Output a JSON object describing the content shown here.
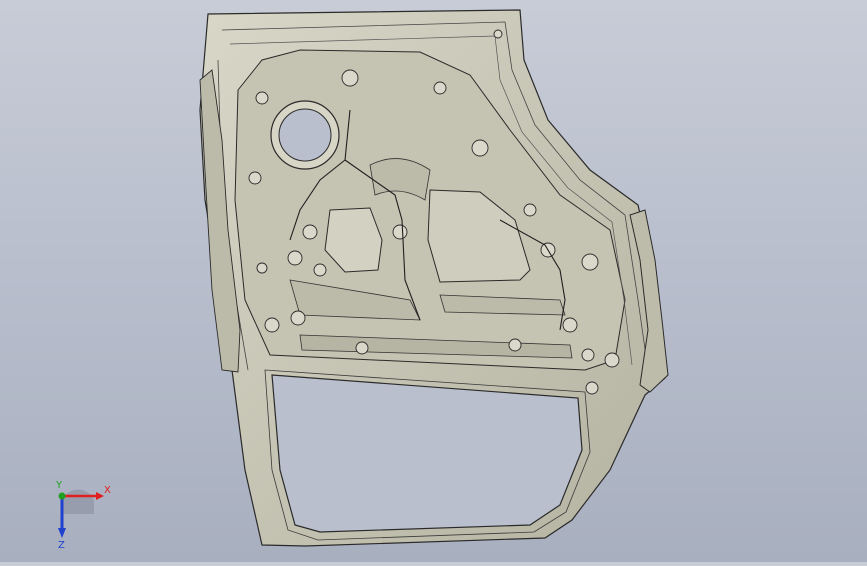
{
  "viewport": {
    "background_top": "#c8ccd7",
    "background_bottom": "#a8afbf",
    "part_fill": "#c9c8b8",
    "part_shade": "#aeac9a",
    "edge_color": "#2a2a2a"
  },
  "triad": {
    "x_label": "X",
    "y_label": "Y",
    "z_label": "Z",
    "x_color": "#e02020",
    "y_color": "#20a020",
    "z_color": "#2040d0"
  }
}
